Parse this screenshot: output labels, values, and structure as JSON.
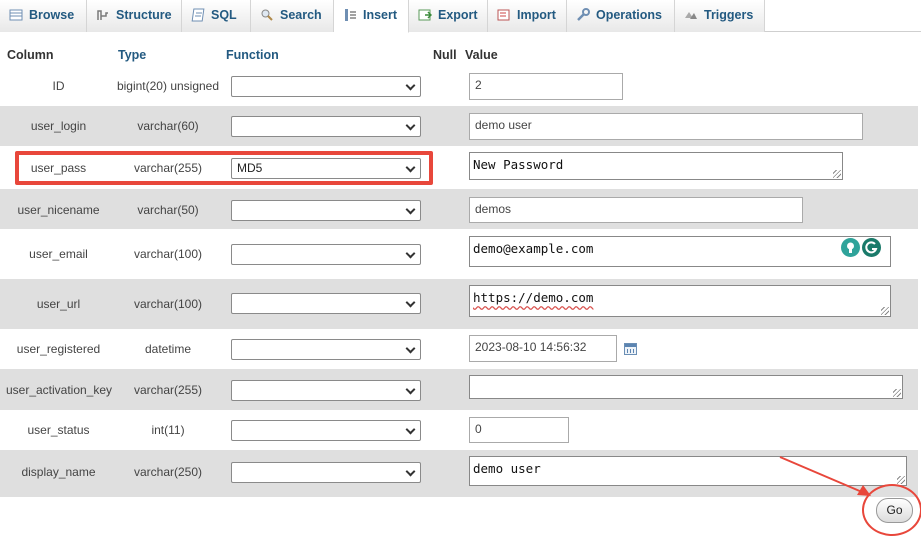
{
  "tabs": [
    {
      "label": "Browse",
      "icon": "browse-icon"
    },
    {
      "label": "Structure",
      "icon": "structure-icon"
    },
    {
      "label": "SQL",
      "icon": "sql-icon"
    },
    {
      "label": "Search",
      "icon": "search-icon"
    },
    {
      "label": "Insert",
      "icon": "insert-icon",
      "active": true
    },
    {
      "label": "Export",
      "icon": "export-icon"
    },
    {
      "label": "Import",
      "icon": "import-icon"
    },
    {
      "label": "Operations",
      "icon": "wrench-icon"
    },
    {
      "label": "Triggers",
      "icon": "triggers-icon"
    }
  ],
  "header": {
    "column": "Column",
    "type": "Type",
    "function": "Function",
    "null": "Null",
    "value": "Value"
  },
  "rows": [
    {
      "column": "ID",
      "type": "bigint(20) unsigned",
      "function": "",
      "value": "2"
    },
    {
      "column": "user_login",
      "type": "varchar(60)",
      "function": "",
      "value": "demo user"
    },
    {
      "column": "user_pass",
      "type": "varchar(255)",
      "function": "MD5",
      "value": "New Password"
    },
    {
      "column": "user_nicename",
      "type": "varchar(50)",
      "function": "",
      "value": "demos"
    },
    {
      "column": "user_email",
      "type": "varchar(100)",
      "function": "",
      "value": "demo@example.com"
    },
    {
      "column": "user_url",
      "type": "varchar(100)",
      "function": "",
      "value": "https://demo.com"
    },
    {
      "column": "user_registered",
      "type": "datetime",
      "function": "",
      "value": "2023-08-10 14:56:32"
    },
    {
      "column": "user_activation_key",
      "type": "varchar(255)",
      "function": "",
      "value": ""
    },
    {
      "column": "user_status",
      "type": "int(11)",
      "function": "",
      "value": "0"
    },
    {
      "column": "display_name",
      "type": "varchar(250)",
      "function": "",
      "value": "demo user"
    }
  ],
  "go_button": "Go",
  "colors": {
    "tab_text": "#235a81",
    "annotation": "#e8473b",
    "row_alt": "#dfdfdf"
  }
}
